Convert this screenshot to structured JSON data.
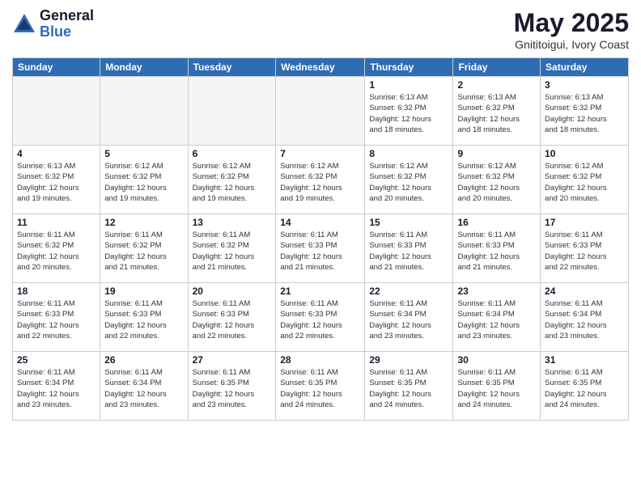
{
  "header": {
    "logo_general": "General",
    "logo_blue": "Blue",
    "title": "May 2025",
    "location": "Gnititoigui, Ivory Coast"
  },
  "weekdays": [
    "Sunday",
    "Monday",
    "Tuesday",
    "Wednesday",
    "Thursday",
    "Friday",
    "Saturday"
  ],
  "weeks": [
    [
      {
        "day": "",
        "info": ""
      },
      {
        "day": "",
        "info": ""
      },
      {
        "day": "",
        "info": ""
      },
      {
        "day": "",
        "info": ""
      },
      {
        "day": "1",
        "info": "Sunrise: 6:13 AM\nSunset: 6:32 PM\nDaylight: 12 hours\nand 18 minutes."
      },
      {
        "day": "2",
        "info": "Sunrise: 6:13 AM\nSunset: 6:32 PM\nDaylight: 12 hours\nand 18 minutes."
      },
      {
        "day": "3",
        "info": "Sunrise: 6:13 AM\nSunset: 6:32 PM\nDaylight: 12 hours\nand 18 minutes."
      }
    ],
    [
      {
        "day": "4",
        "info": "Sunrise: 6:13 AM\nSunset: 6:32 PM\nDaylight: 12 hours\nand 19 minutes."
      },
      {
        "day": "5",
        "info": "Sunrise: 6:12 AM\nSunset: 6:32 PM\nDaylight: 12 hours\nand 19 minutes."
      },
      {
        "day": "6",
        "info": "Sunrise: 6:12 AM\nSunset: 6:32 PM\nDaylight: 12 hours\nand 19 minutes."
      },
      {
        "day": "7",
        "info": "Sunrise: 6:12 AM\nSunset: 6:32 PM\nDaylight: 12 hours\nand 19 minutes."
      },
      {
        "day": "8",
        "info": "Sunrise: 6:12 AM\nSunset: 6:32 PM\nDaylight: 12 hours\nand 20 minutes."
      },
      {
        "day": "9",
        "info": "Sunrise: 6:12 AM\nSunset: 6:32 PM\nDaylight: 12 hours\nand 20 minutes."
      },
      {
        "day": "10",
        "info": "Sunrise: 6:12 AM\nSunset: 6:32 PM\nDaylight: 12 hours\nand 20 minutes."
      }
    ],
    [
      {
        "day": "11",
        "info": "Sunrise: 6:11 AM\nSunset: 6:32 PM\nDaylight: 12 hours\nand 20 minutes."
      },
      {
        "day": "12",
        "info": "Sunrise: 6:11 AM\nSunset: 6:32 PM\nDaylight: 12 hours\nand 21 minutes."
      },
      {
        "day": "13",
        "info": "Sunrise: 6:11 AM\nSunset: 6:32 PM\nDaylight: 12 hours\nand 21 minutes."
      },
      {
        "day": "14",
        "info": "Sunrise: 6:11 AM\nSunset: 6:33 PM\nDaylight: 12 hours\nand 21 minutes."
      },
      {
        "day": "15",
        "info": "Sunrise: 6:11 AM\nSunset: 6:33 PM\nDaylight: 12 hours\nand 21 minutes."
      },
      {
        "day": "16",
        "info": "Sunrise: 6:11 AM\nSunset: 6:33 PM\nDaylight: 12 hours\nand 21 minutes."
      },
      {
        "day": "17",
        "info": "Sunrise: 6:11 AM\nSunset: 6:33 PM\nDaylight: 12 hours\nand 22 minutes."
      }
    ],
    [
      {
        "day": "18",
        "info": "Sunrise: 6:11 AM\nSunset: 6:33 PM\nDaylight: 12 hours\nand 22 minutes."
      },
      {
        "day": "19",
        "info": "Sunrise: 6:11 AM\nSunset: 6:33 PM\nDaylight: 12 hours\nand 22 minutes."
      },
      {
        "day": "20",
        "info": "Sunrise: 6:11 AM\nSunset: 6:33 PM\nDaylight: 12 hours\nand 22 minutes."
      },
      {
        "day": "21",
        "info": "Sunrise: 6:11 AM\nSunset: 6:33 PM\nDaylight: 12 hours\nand 22 minutes."
      },
      {
        "day": "22",
        "info": "Sunrise: 6:11 AM\nSunset: 6:34 PM\nDaylight: 12 hours\nand 23 minutes."
      },
      {
        "day": "23",
        "info": "Sunrise: 6:11 AM\nSunset: 6:34 PM\nDaylight: 12 hours\nand 23 minutes."
      },
      {
        "day": "24",
        "info": "Sunrise: 6:11 AM\nSunset: 6:34 PM\nDaylight: 12 hours\nand 23 minutes."
      }
    ],
    [
      {
        "day": "25",
        "info": "Sunrise: 6:11 AM\nSunset: 6:34 PM\nDaylight: 12 hours\nand 23 minutes."
      },
      {
        "day": "26",
        "info": "Sunrise: 6:11 AM\nSunset: 6:34 PM\nDaylight: 12 hours\nand 23 minutes."
      },
      {
        "day": "27",
        "info": "Sunrise: 6:11 AM\nSunset: 6:35 PM\nDaylight: 12 hours\nand 23 minutes."
      },
      {
        "day": "28",
        "info": "Sunrise: 6:11 AM\nSunset: 6:35 PM\nDaylight: 12 hours\nand 24 minutes."
      },
      {
        "day": "29",
        "info": "Sunrise: 6:11 AM\nSunset: 6:35 PM\nDaylight: 12 hours\nand 24 minutes."
      },
      {
        "day": "30",
        "info": "Sunrise: 6:11 AM\nSunset: 6:35 PM\nDaylight: 12 hours\nand 24 minutes."
      },
      {
        "day": "31",
        "info": "Sunrise: 6:11 AM\nSunset: 6:35 PM\nDaylight: 12 hours\nand 24 minutes."
      }
    ]
  ]
}
